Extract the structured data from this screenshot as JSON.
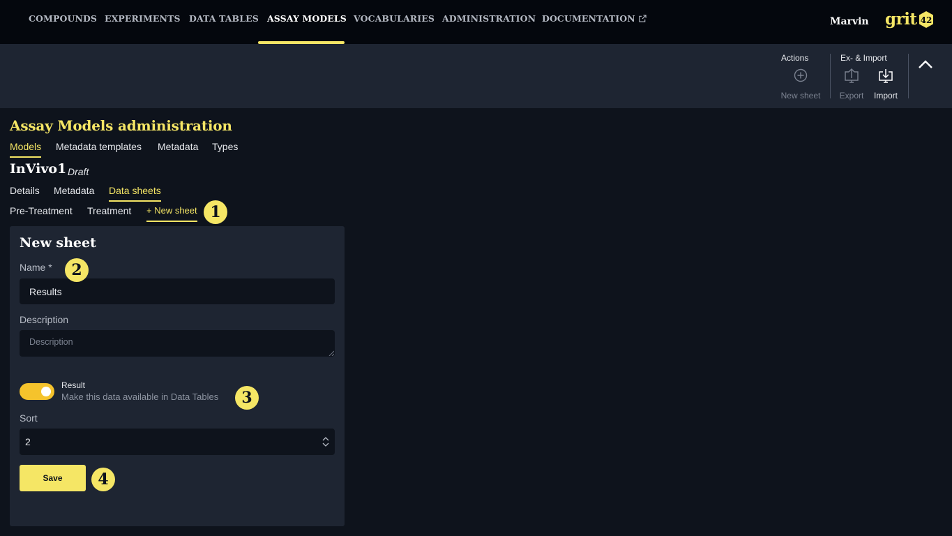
{
  "nav": {
    "items": [
      {
        "label": "COMPOUNDS"
      },
      {
        "label": "EXPERIMENTS"
      },
      {
        "label": "DATA TABLES"
      },
      {
        "label": "ASSAY MODELS",
        "active": true
      },
      {
        "label": "VOCABULARIES"
      },
      {
        "label": "ADMINISTRATION"
      },
      {
        "label": "DOCUMENTATION",
        "external": true
      }
    ],
    "user": "Marvin",
    "logo_text": "grit",
    "logo_badge": "42"
  },
  "toolbar": {
    "actions_label": "Actions",
    "new_sheet_label": "New sheet",
    "import_group_label": "Ex- & Import",
    "export_label": "Export",
    "import_label": "Import"
  },
  "page": {
    "title": "Assay Models administration",
    "admin_tabs": [
      {
        "label": "Models",
        "active": true
      },
      {
        "label": "Metadata templates"
      },
      {
        "label": "Metadata"
      },
      {
        "label": "Types"
      }
    ],
    "model_name": "InVivo1",
    "model_status": "Draft",
    "model_tabs": [
      {
        "label": "Details"
      },
      {
        "label": "Metadata"
      },
      {
        "label": "Data sheets",
        "active": true
      }
    ],
    "sheet_tabs": [
      {
        "label": "Pre-Treatment"
      },
      {
        "label": "Treatment"
      },
      {
        "label": "+ New sheet",
        "active": true
      }
    ]
  },
  "form": {
    "title": "New sheet",
    "name_label": "Name *",
    "name_value": "Results",
    "description_label": "Description",
    "description_placeholder": "Description",
    "result_toggle_on": true,
    "result_label": "Result",
    "result_hint": "Make this data available in Data Tables",
    "sort_label": "Sort",
    "sort_value": "2",
    "save_label": "Save"
  },
  "badges": [
    "1",
    "2",
    "3",
    "4"
  ],
  "colors": {
    "accent": "#f5e665",
    "toggle": "#f5c32c",
    "nav_bg": "#04070d",
    "panel_bg": "#1e2532",
    "page_bg": "#0e131c"
  }
}
